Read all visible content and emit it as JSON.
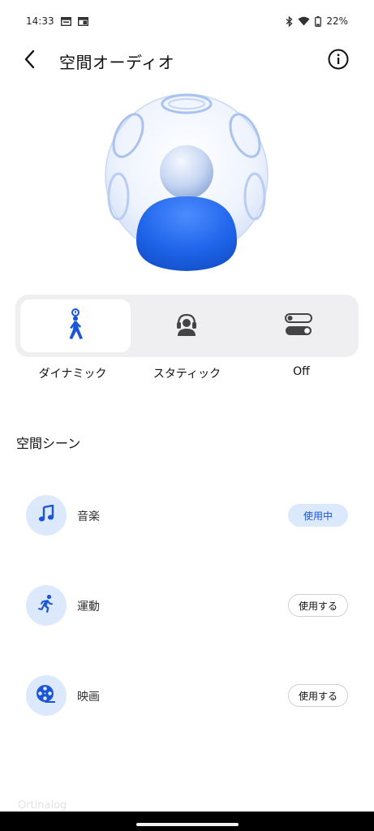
{
  "status_bar": {
    "time": "14:33",
    "left_icons": [
      "notification-window-icon",
      "notification-window-icon"
    ],
    "right_icons": [
      "bluetooth-icon",
      "wifi-icon",
      "battery-icon"
    ],
    "battery": "22%"
  },
  "header": {
    "title": "空間オーディオ",
    "back_icon": "chevron-left-icon",
    "info_icon": "info-icon"
  },
  "illustration": {
    "name": "spatial-audio-sphere-illustration"
  },
  "modes": {
    "selected_index": 0,
    "items": [
      {
        "label": "ダイナミック",
        "icon": "walking-person-icon"
      },
      {
        "label": "スタティック",
        "icon": "headphones-person-icon"
      },
      {
        "label": "Off",
        "icon": "toggle-off-icon"
      }
    ]
  },
  "scenes": {
    "title": "空間シーン",
    "items": [
      {
        "label": "音楽",
        "icon": "music-note-icon",
        "button": "使用中",
        "active": true
      },
      {
        "label": "運動",
        "icon": "running-icon",
        "button": "使用する",
        "active": false
      },
      {
        "label": "映画",
        "icon": "film-reel-icon",
        "button": "使用する",
        "active": false
      }
    ]
  },
  "watermark": "Ortinalog",
  "colors": {
    "accent": "#1a56d6",
    "accent_light": "#dce8fb",
    "segment_bg": "#efeff1"
  }
}
